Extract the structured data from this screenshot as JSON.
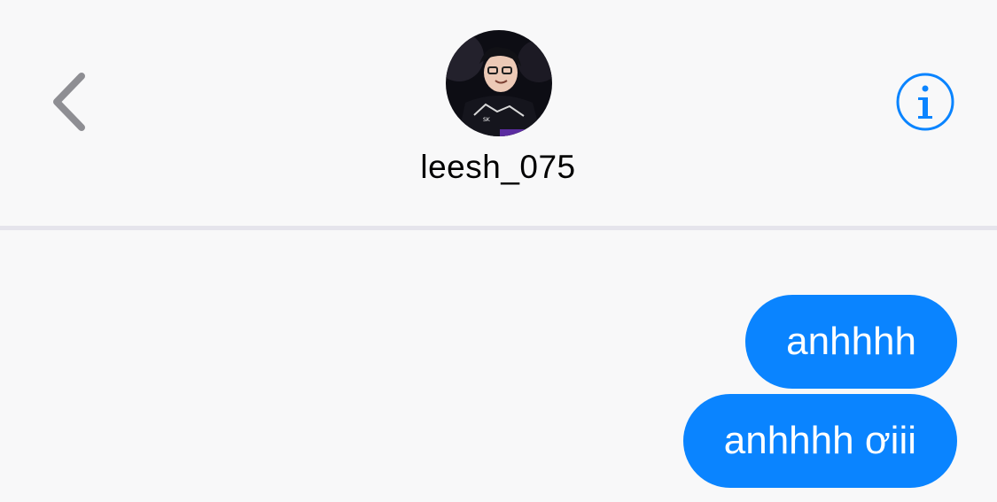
{
  "header": {
    "contact_name": "leesh_075",
    "back_icon": "chevron-left-icon",
    "info_icon": "info-circle-icon",
    "accent_color": "#0a84ff"
  },
  "messages": [
    {
      "sender": "me",
      "text": "anhhhh"
    },
    {
      "sender": "me",
      "text": "anhhhh ơiii"
    }
  ]
}
